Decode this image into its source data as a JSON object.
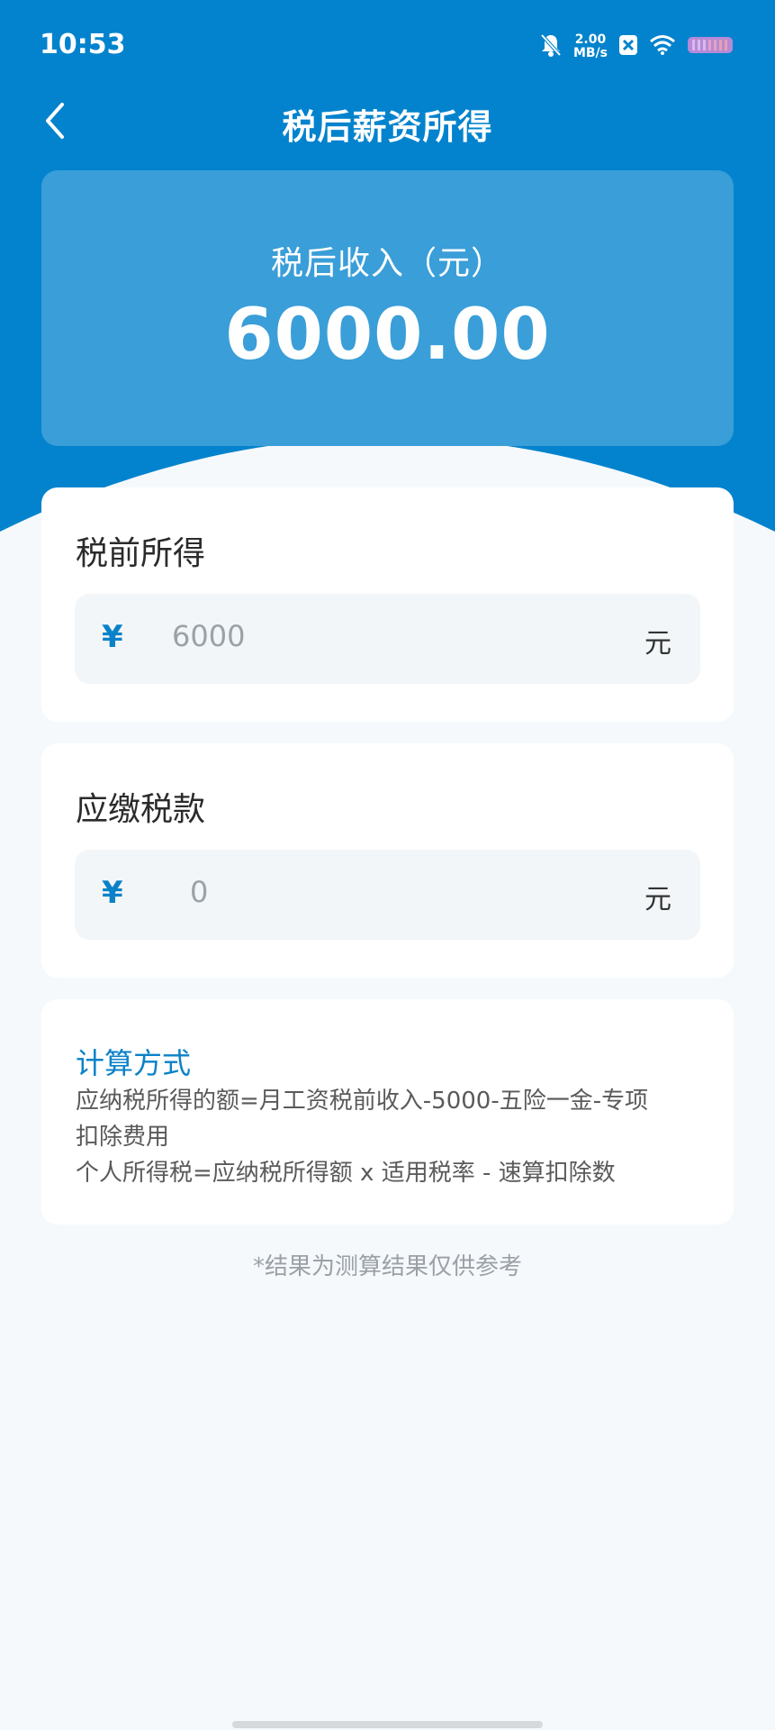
{
  "status_bar": {
    "time": "10:53",
    "net_speed_value": "2.00",
    "net_speed_unit": "MB/s"
  },
  "nav": {
    "title": "税后薪资所得"
  },
  "summary": {
    "label": "税后收入（元）",
    "value": "6000.00"
  },
  "pretax": {
    "title": "税前所得",
    "currency": "¥",
    "value": "6000",
    "unit": "元"
  },
  "tax": {
    "title": "应缴税款",
    "currency": "¥",
    "value": "0",
    "unit": "元"
  },
  "method": {
    "title": "计算方式",
    "line1": "应纳税所得的额=月工资税前收入-5000-五险一金-专项",
    "line2": "扣除费用",
    "line3": "个人所得税=应纳税所得额 x 适用税率 - 速算扣除数"
  },
  "disclaimer": "*结果为测算结果仅供参考",
  "colors": {
    "primary": "#0383cd",
    "card_highlight": "#3a9ed8",
    "accent_text": "#0a82c8",
    "background": "#f5f9fc"
  }
}
